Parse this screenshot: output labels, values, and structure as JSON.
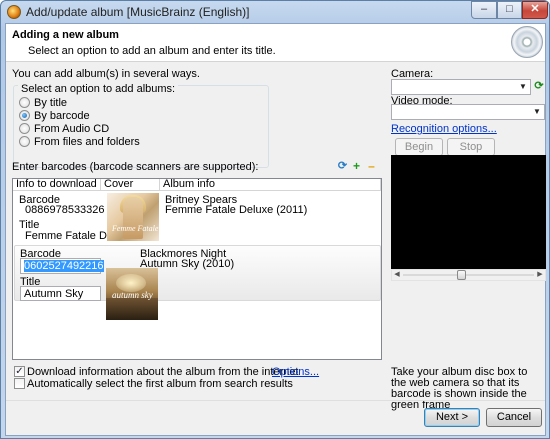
{
  "window": {
    "title": "Add/update album [MusicBrainz (English)]",
    "min_glyph": "–",
    "max_glyph": "□",
    "close_glyph": "✕"
  },
  "header": {
    "title": "Adding a new album",
    "subtitle": "Select an option to add an album and enter its title."
  },
  "intro": "You can add album(s) in several ways.",
  "options": {
    "group_label": "Select an option to add albums:",
    "items": [
      {
        "label": "By title",
        "selected": false
      },
      {
        "label": "By barcode",
        "selected": true
      },
      {
        "label": "From Audio CD",
        "selected": false
      },
      {
        "label": "From files and folders",
        "selected": false
      }
    ]
  },
  "barcodes": {
    "label": "Enter barcodes (barcode scanners are supported):",
    "icons": [
      "refresh-icon",
      "add-icon",
      "remove-icon"
    ],
    "columns": [
      "Info to download",
      "Cover",
      "Album info"
    ],
    "rows": [
      {
        "barcode_label": "Barcode",
        "barcode": "0886978533326",
        "title_label": "Title",
        "title": "Femme Fatale Deluxe",
        "cover_text": "Femme Fatale",
        "artist": "Britney Spears",
        "album": "Femme Fatale Deluxe (2011)"
      },
      {
        "barcode_label": "Barcode",
        "barcode": "0602527492216",
        "title_label": "Title",
        "title": "Autumn Sky",
        "cover_text": "autumn sky",
        "artist": "Blackmores Night",
        "album": "Autumn Sky (2010)"
      }
    ]
  },
  "checkboxes": [
    {
      "label": "Download information about the album from the internet",
      "checked": true
    },
    {
      "label": "Automatically select the first album from search results",
      "checked": false
    }
  ],
  "options_link": "Options...",
  "camera": {
    "camera_label": "Camera:",
    "camera_value": "",
    "video_mode_label": "Video mode:",
    "video_mode_value": "",
    "recognition_link": "Recognition options...",
    "begin_button": "Begin",
    "stop_button": "Stop",
    "hint": "Take your album disc box to the web camera so that its barcode is shown inside the green frame",
    "slider_level": 0.44
  },
  "buttons": {
    "next": "Next >",
    "cancel": "Cancel"
  },
  "colors": {
    "title_bar": "#b2c9e6",
    "close_button": "#c7463a",
    "link": "#0033cc",
    "selection": "#3399ff",
    "add_icon": "#1f9b1f",
    "remove_icon": "#e0a000"
  }
}
